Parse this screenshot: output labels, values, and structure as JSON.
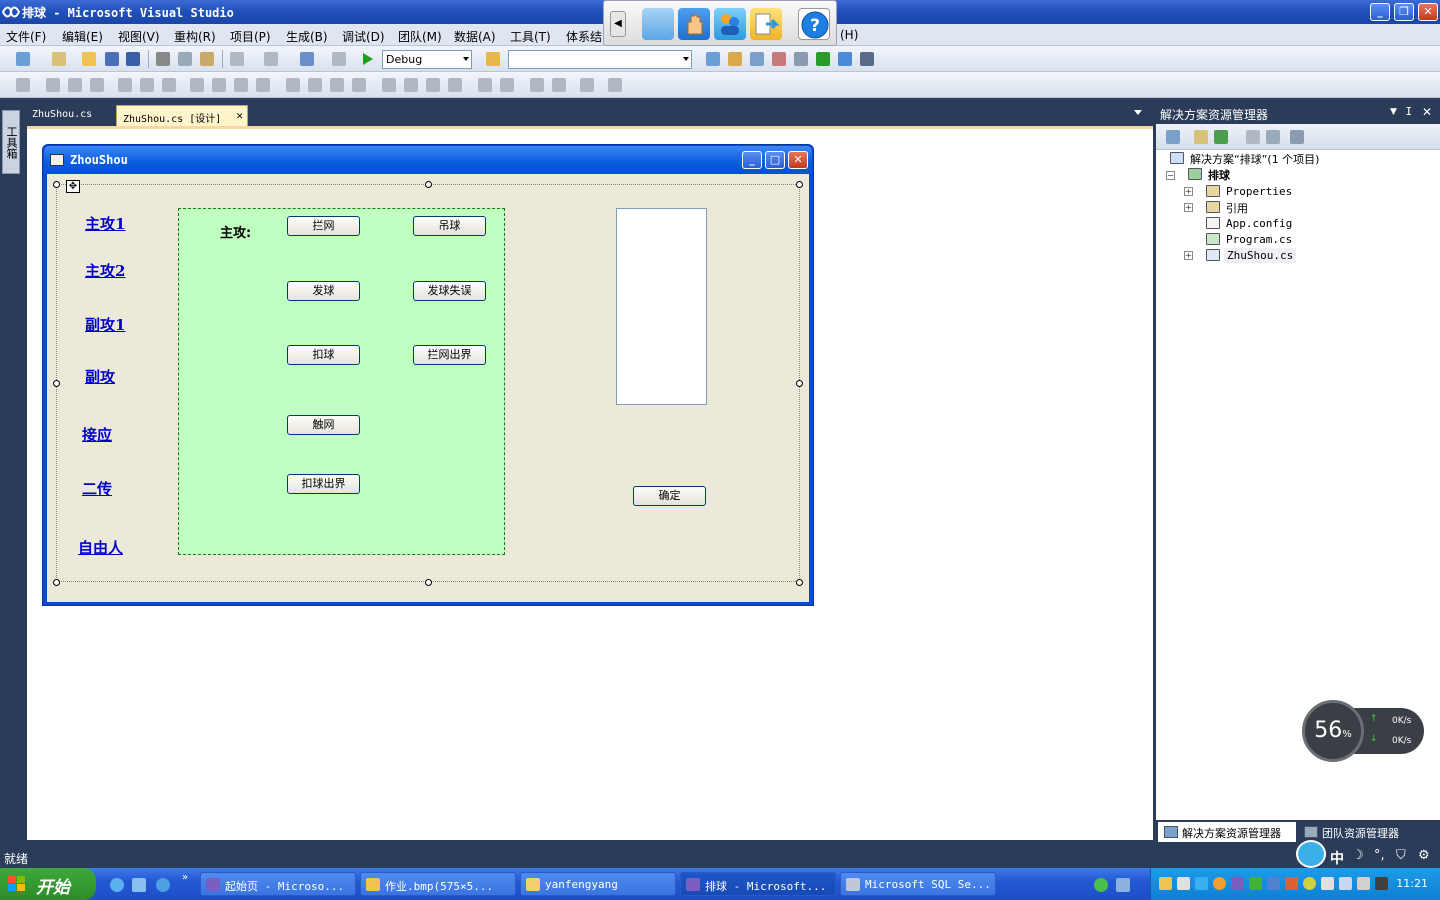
{
  "window": {
    "title": "排球 - Microsoft Visual Studio"
  },
  "menu": [
    "文件(F)",
    "编辑(E)",
    "视图(V)",
    "重构(R)",
    "项目(P)",
    "生成(B)",
    "调试(D)",
    "团队(M)",
    "数据(A)",
    "工具(T)",
    "体系结",
    "(H)"
  ],
  "toolbar": {
    "config": "Debug",
    "search_value": ""
  },
  "toolbox": {
    "label": "工具箱"
  },
  "doc_tabs": [
    {
      "label": "ZhuShou.cs",
      "active": false
    },
    {
      "label": "ZhuShou.cs [设计]",
      "active": true
    }
  ],
  "form": {
    "title": "ZhouShou",
    "links": [
      "主攻1",
      "主攻2",
      "副攻1",
      "副攻",
      "接应",
      "二传",
      "自由人"
    ],
    "group_label": "主攻:",
    "buttons": [
      "拦网",
      "吊球",
      "发球",
      "发球失误",
      "扣球",
      "拦网出界",
      "触网",
      "扣球出界"
    ],
    "ok_button": "确定"
  },
  "solution_explorer": {
    "title": "解决方案资源管理器",
    "solution": "解决方案“排球”(1 个项目)",
    "project": "排球",
    "items": [
      "Properties",
      "引用",
      "App.config",
      "Program.cs",
      "ZhuShou.cs"
    ]
  },
  "bottom_tabs": [
    "解决方案资源管理器",
    "团队资源管理器"
  ],
  "net_widget": {
    "percent": "56",
    "unit": "%",
    "up": "0K/s",
    "down": "0K/s"
  },
  "status": "就绪",
  "taskbar": {
    "start": "开始",
    "tasks": [
      "起始页 - Microso...",
      "作业.bmp(575×5...",
      "yanfengyang",
      "排球 - Microsoft...",
      "Microsoft SQL Se..."
    ],
    "ime": "中",
    "time": "11:21"
  },
  "colors": {
    "title": "#1f4fb8",
    "form_title": "#0a5ce0",
    "group": "#c0ffc0",
    "link": "#0000cc"
  }
}
